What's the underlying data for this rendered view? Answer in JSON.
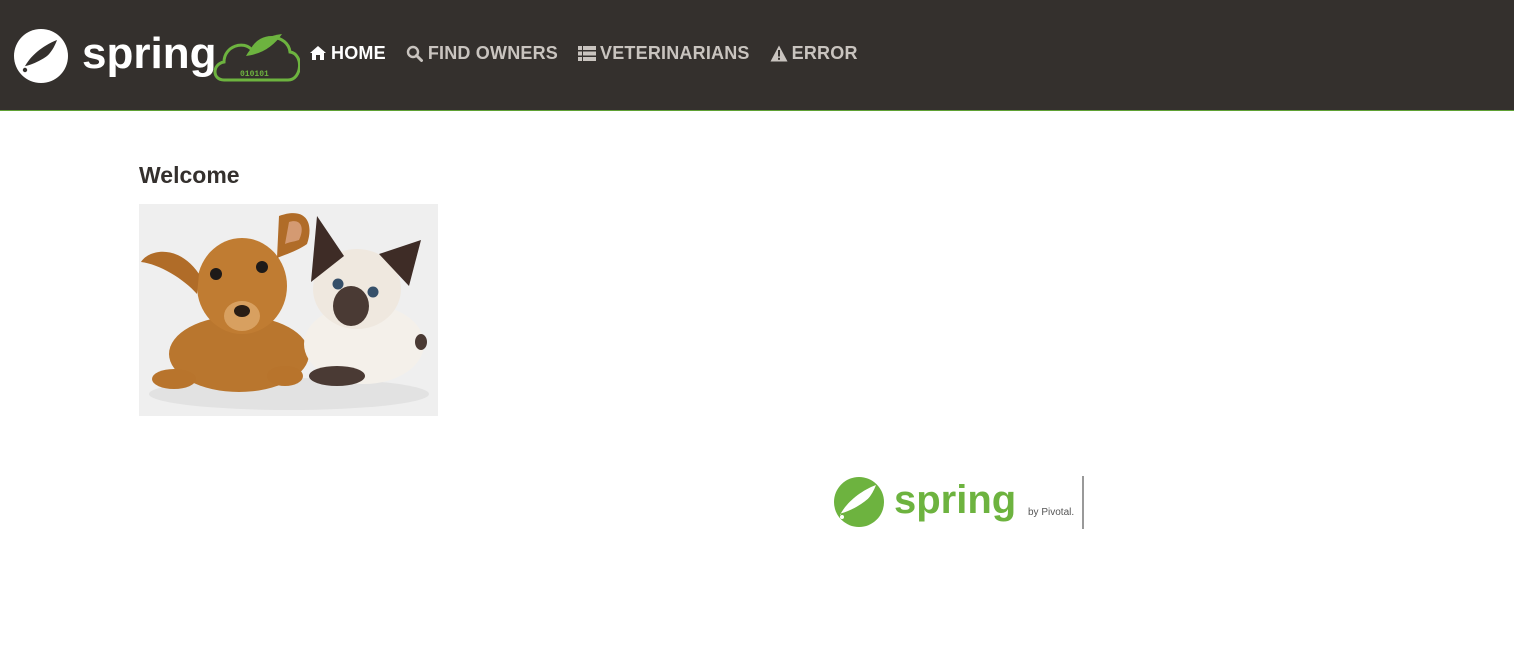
{
  "brand": {
    "wordmark": "spring",
    "cloud_digits": "010101"
  },
  "nav": {
    "items": [
      {
        "label": "HOME",
        "icon": "home-icon",
        "active": true
      },
      {
        "label": "FIND OWNERS",
        "icon": "search-icon",
        "active": false
      },
      {
        "label": "VETERINARIANS",
        "icon": "list-icon",
        "active": false
      },
      {
        "label": "ERROR",
        "icon": "warning-icon",
        "active": false
      }
    ]
  },
  "main": {
    "title": "Welcome",
    "image_subject": "pets-image"
  },
  "footer": {
    "wordmark": "spring",
    "byline": "by Pivotal."
  },
  "colors": {
    "navbar_bg": "#34302d",
    "spring_green": "#6db33f",
    "nav_text": "#c9c4bf",
    "nav_active": "#ffffff",
    "title_text": "#34302d"
  }
}
